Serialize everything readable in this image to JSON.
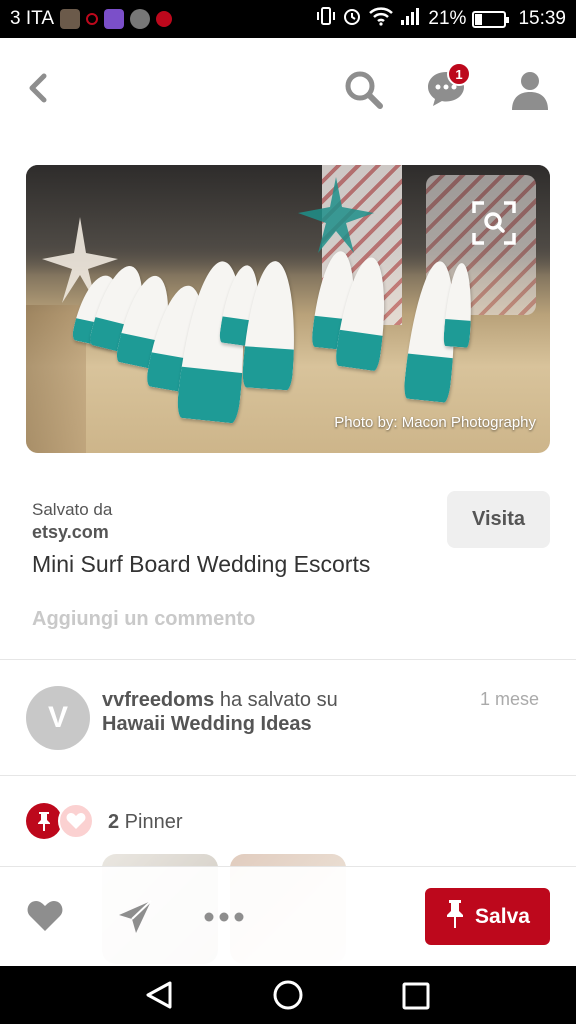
{
  "status_bar": {
    "carrier": "3 ITA",
    "battery": "21%",
    "time": "15:39"
  },
  "toolbar": {
    "back_icon": "chevron-left-icon",
    "search_icon": "search-icon",
    "messages_icon": "chat-bubble-icon",
    "messages_badge": "1",
    "profile_icon": "person-icon"
  },
  "pin": {
    "photo_credit": "Photo by: Macon Photography",
    "zoom_icon": "visual-search-icon",
    "saved_from_label": "Salvato da",
    "source": "etsy.com",
    "visit_label": "Visita",
    "title": "Mini Surf Board Wedding Escorts",
    "add_comment": "Aggiungi un commento"
  },
  "saver": {
    "avatar_letter": "V",
    "username": "vvfreedoms",
    "action": " ha salvato su",
    "board": "Hawaii Wedding Ideas",
    "time": "1 mese"
  },
  "pinners": {
    "count": "2",
    "label": " Pinner"
  },
  "actions": {
    "like_icon": "heart-icon",
    "send_icon": "send-icon",
    "more_icon": "more-dots-icon",
    "save_label": "Salva"
  },
  "colors": {
    "brand_red": "#bd081c",
    "icon_gray": "#8e8e8e",
    "text_dark": "#333333"
  }
}
